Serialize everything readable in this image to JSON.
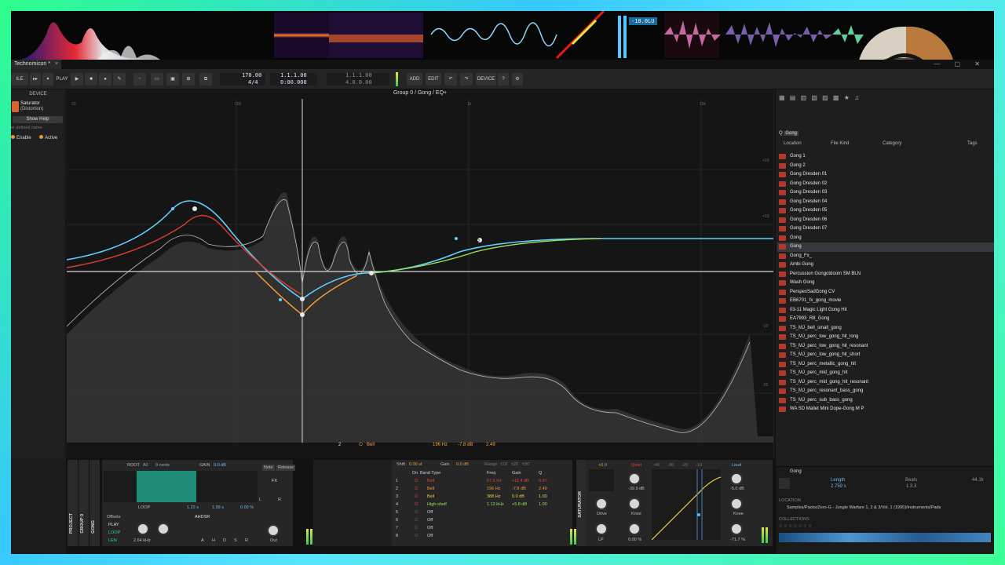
{
  "colors": {
    "accent": "#e99a2f",
    "eq_blue": "#5fd0ff",
    "eq_red": "#d63d2f",
    "eq_orange": "#f0a23a",
    "eq_green": "#9de25a",
    "lu_badge": "#1a6b9c"
  },
  "viz": {
    "lu_readout": "-18.0LU"
  },
  "tab": {
    "title": "Technomicon *",
    "close": "×"
  },
  "toolbar": {
    "file_btn": "ILE",
    "play_label": "PLAY",
    "tempo": "170.00",
    "signature": "4/4",
    "position_bars": "1.1.1.00",
    "position_time": "0:00.000",
    "loop_start": "1.1.1.00",
    "loop_len": "4.0.0.00",
    "add_label": "ADD",
    "edit_label": "EDIT",
    "device_label": "DEVICE"
  },
  "left_panel": {
    "header": "DEVICE",
    "device_name": "Saturator",
    "device_type": "(Distortion)",
    "help_button": "Show Help",
    "user_name_placeholder": "er defined name",
    "enable_label": "Enable",
    "active_label": "Active"
  },
  "eq": {
    "title": "Group 0 / Gong / EQ+",
    "freq_ticks": [
      "20",
      "100",
      "1k",
      "10k"
    ],
    "db_ticks": [
      "+20",
      "+10",
      "-10",
      "-20"
    ],
    "band_nodes": [
      "2",
      "3"
    ],
    "status": {
      "band_num": "2",
      "band_type": "Bell",
      "freq": "196 Hz",
      "gain": "-7.8 dB",
      "q": "2.49"
    }
  },
  "browser": {
    "search_prefix": "Q",
    "search_query": "Gong",
    "columns": [
      "Location",
      "File Kind",
      "Category",
      "Tags"
    ],
    "files": [
      "Gong 1",
      "Gong 2",
      "Gong Dresden 01",
      "Gong Dresden 02",
      "Gong Dresden 03",
      "Gong Dresden 04",
      "Gong Dresden 05",
      "Gong Dresden 06",
      "Gong Dresden 07",
      "Gong",
      "Gong",
      "Gong_Fx_",
      "Ambi Gong",
      "Percussion Gongotdoom SM BLN",
      "Wash Gong",
      "PerspexSadGong CV",
      "EB6701_fx_gong_movie",
      "03-11 Magic Light Gong Hit",
      "EA7993_R8_Gong",
      "TS_MJ_bell_small_gong",
      "TS_MJ_perc_low_gong_hit_long",
      "TS_MJ_perc_low_gong_hit_resonant",
      "TS_MJ_perc_low_gong_hit_short",
      "TS_MJ_perc_metallic_gong_hit",
      "TS_MJ_perc_mid_gong_hit",
      "TS_MJ_perc_mid_gong_hit_resonant",
      "TS_MJ_perc_resonant_bass_gong",
      "TS_MJ_perc_sub_bass_gong",
      "WA SD Mallet Mini Dope-Gong M P"
    ],
    "selected_index": 10,
    "info": {
      "name": "Gong",
      "length_label": "Length",
      "length_value": "2.759 s",
      "beats_label": "Beats",
      "beats_value": "1.3.3",
      "rate_value": "44.1k",
      "location_label": "LOCATION",
      "location_path": "Samples/Packs/Zero-G - Jungle Warfare 1, 2 & 3/Vol. 1 (1995)/Instruments/Pads",
      "collections_label": "COLLECTIONS"
    }
  },
  "bottom": {
    "side_labels": [
      "PROJECT",
      "GROUP 0",
      "GONG"
    ],
    "sampler": {
      "root_label": "ROOT",
      "root_value": "A2",
      "cents": "0 cents",
      "gain_label": "GAIN",
      "gain_value": "0.0 dB",
      "note_tab": "Note",
      "release_tab": "Release",
      "fx_label": "FX",
      "loop_label": "LOOP",
      "loop_time": "1.22 s",
      "loop_len": "1.99 s",
      "loop_pct": "0.00 %",
      "offsets_label": "Offsets",
      "play_mode": "PLAY",
      "loop_mode": "LOOP",
      "len_mode": "LEN",
      "env_label": "AHDSR",
      "env_letters": [
        "A",
        "H",
        "D",
        "S",
        "R"
      ],
      "freq_value": "2.64 kHz",
      "out_label": "Out",
      "l_label": "L",
      "r_label": "R"
    },
    "eqplus": {
      "shift_label": "Shift",
      "shift_value": "0.00 st",
      "gain_label": "Gain",
      "gain_value": "0.0 dB",
      "range_label": "Range",
      "range_opts": [
        "±10",
        "±20",
        "±30"
      ],
      "headers": [
        "On",
        "Band Type",
        "Freq",
        "Gain",
        "Q"
      ],
      "bands": [
        {
          "num": "1",
          "type": "Bell",
          "freq": "67.6 Hz",
          "gain": "+11.4 dB",
          "q": "0.97",
          "color": "#e0443a"
        },
        {
          "num": "2",
          "type": "Bell",
          "freq": "196 Hz",
          "gain": "-7.8 dB",
          "q": "2.49",
          "color": "#f09a33"
        },
        {
          "num": "3",
          "type": "Bell",
          "freq": "388 Hz",
          "gain": "0.0 dB",
          "q": "1.00",
          "color": "#e8d04a"
        },
        {
          "num": "4",
          "type": "High-shelf",
          "freq": "1.13 kHz",
          "gain": "+5.8 dB",
          "q": "1.00",
          "color": "#9de25a"
        },
        {
          "num": "5",
          "type": "Off",
          "freq": "",
          "gain": "",
          "q": "",
          "color": "#cfcfcf"
        },
        {
          "num": "6",
          "type": "Off",
          "freq": "",
          "gain": "",
          "q": "",
          "color": "#cfcfcf"
        },
        {
          "num": "7",
          "type": "Off",
          "freq": "",
          "gain": "",
          "q": "",
          "color": "#cfcfcf"
        },
        {
          "num": "8",
          "type": "Off",
          "freq": "",
          "gain": "",
          "q": "",
          "color": "#cfcfcf"
        }
      ]
    },
    "saturator": {
      "title": "SATURATOR",
      "input_value": "+0.0",
      "quiet_label": "Quiet",
      "loud_label": "Loud",
      "quiet_value": "-39.9 dB",
      "loud_value": "-5.0 dB",
      "drive_label": "Drive",
      "knee_label": "Knee",
      "knee2_label": "Knee",
      "out_pct": "0.00 %",
      "out_pct2": "-71.7 %",
      "lp_label": "LP",
      "scale": [
        "-40",
        "-30",
        "-20",
        "-10"
      ]
    }
  }
}
